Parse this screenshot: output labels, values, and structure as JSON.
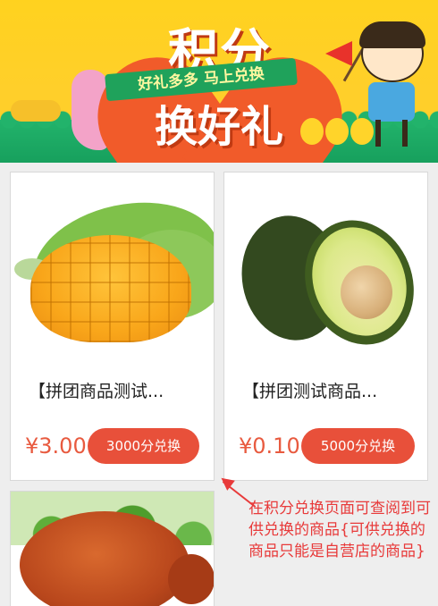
{
  "banner": {
    "title": "积分",
    "ribbon": "好礼多多 马上兑换",
    "subtitle": "换好礼"
  },
  "products": [
    {
      "name": "【拼团商品测试...",
      "price": "¥3.00",
      "redeem_label": "3000分兑换",
      "image": "mango-image"
    },
    {
      "name": "【拼团测试商品...",
      "price": "¥0.10",
      "redeem_label": "5000分兑换",
      "image": "avocado-image"
    },
    {
      "image": "crab-image"
    }
  ],
  "annotation": {
    "text": "在积分兑换页面可查阅到可供兑换的商品{可供兑换的商品只能是自营店的商品}"
  },
  "colors": {
    "accent": "#e8503a",
    "price": "#e85a3f",
    "annotation": "#e83a3a"
  }
}
